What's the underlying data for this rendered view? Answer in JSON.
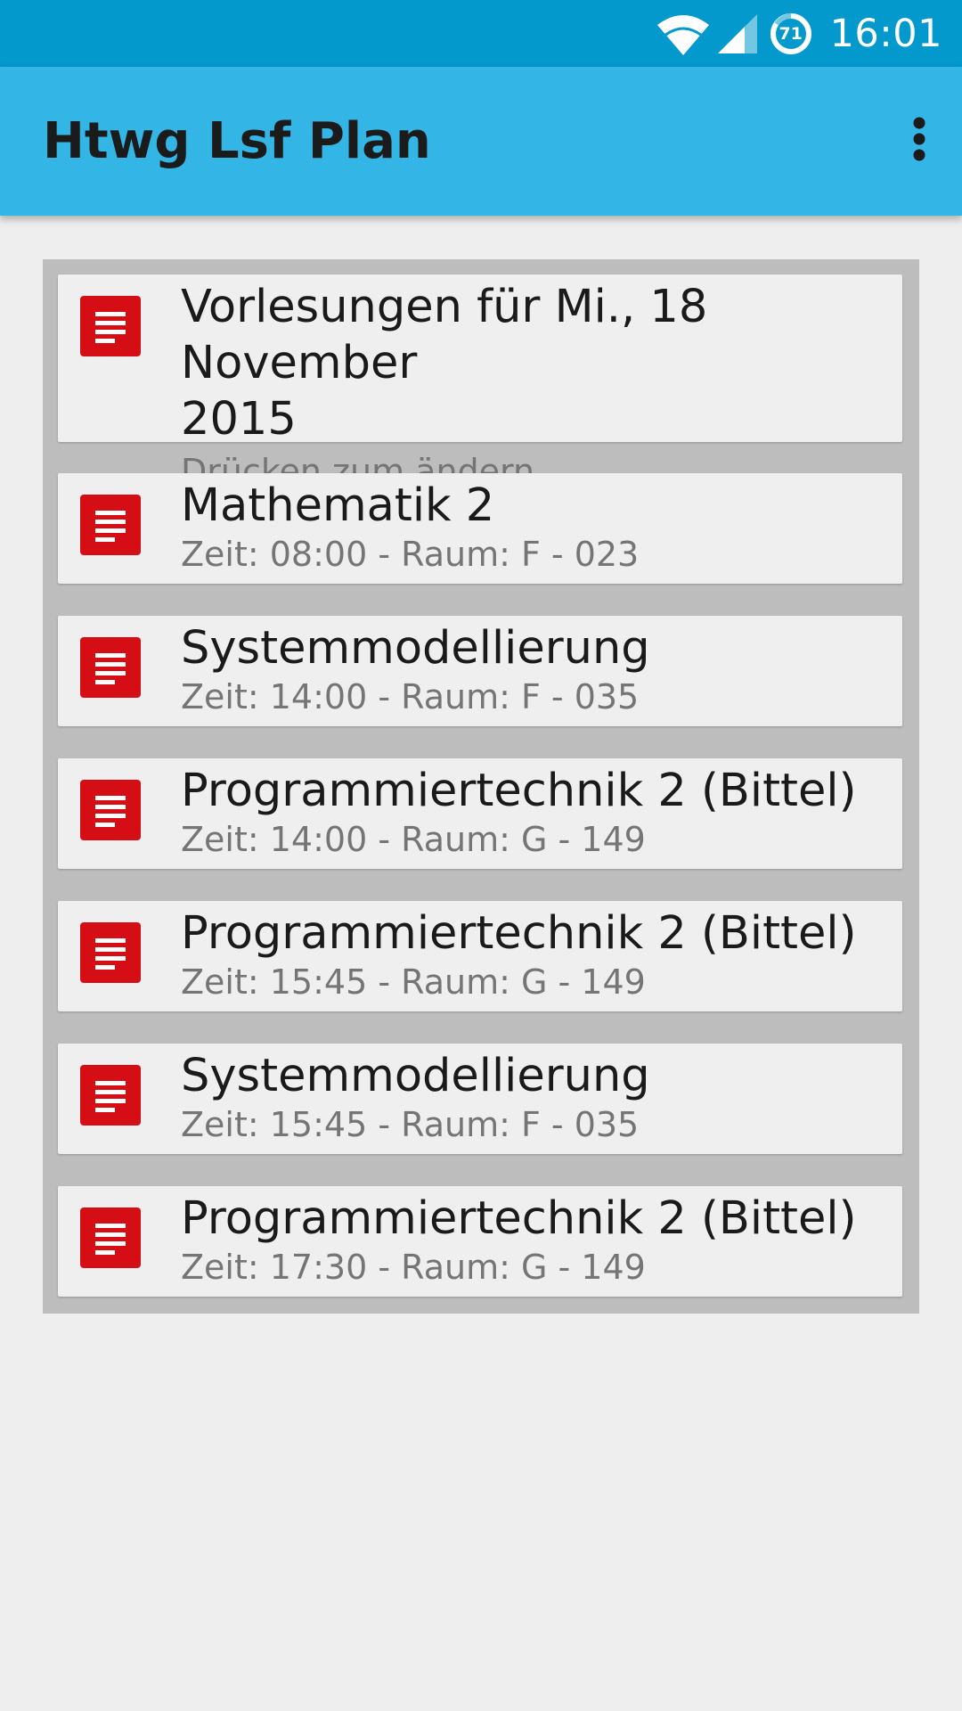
{
  "status_bar": {
    "time": "16:01",
    "battery_level": "71",
    "wifi_icon": "wifi-icon",
    "signal_icon": "cell-signal-icon",
    "battery_icon": "battery-icon"
  },
  "app_bar": {
    "title": "Htwg Lsf Plan",
    "menu_icon": "overflow-menu-icon"
  },
  "colors": {
    "status_bar": "#0399cc",
    "app_bar": "#33b5e5",
    "item_icon": "#d50d15",
    "panel": "#bdbdbd",
    "card": "#efefef"
  },
  "header_item": {
    "title_line1": "Vorlesungen für Mi., 18 November",
    "title_line2": "2015",
    "subtitle": "Drücken zum ändern",
    "icon": "document-icon"
  },
  "lectures": [
    {
      "title": "Mathematik 2",
      "detail": "Zeit: 08:00 - Raum: F - 023",
      "icon": "document-icon"
    },
    {
      "title": "Systemmodellierung",
      "detail": "Zeit: 14:00 - Raum: F - 035",
      "icon": "document-icon"
    },
    {
      "title": "Programmiertechnik 2 (Bittel)",
      "detail": "Zeit: 14:00 - Raum: G - 149",
      "icon": "document-icon"
    },
    {
      "title": "Programmiertechnik 2 (Bittel)",
      "detail": "Zeit: 15:45 - Raum: G - 149",
      "icon": "document-icon"
    },
    {
      "title": "Systemmodellierung",
      "detail": "Zeit: 15:45 - Raum: F - 035",
      "icon": "document-icon"
    },
    {
      "title": "Programmiertechnik 2 (Bittel)",
      "detail": "Zeit: 17:30 - Raum: G - 149",
      "icon": "document-icon"
    }
  ]
}
